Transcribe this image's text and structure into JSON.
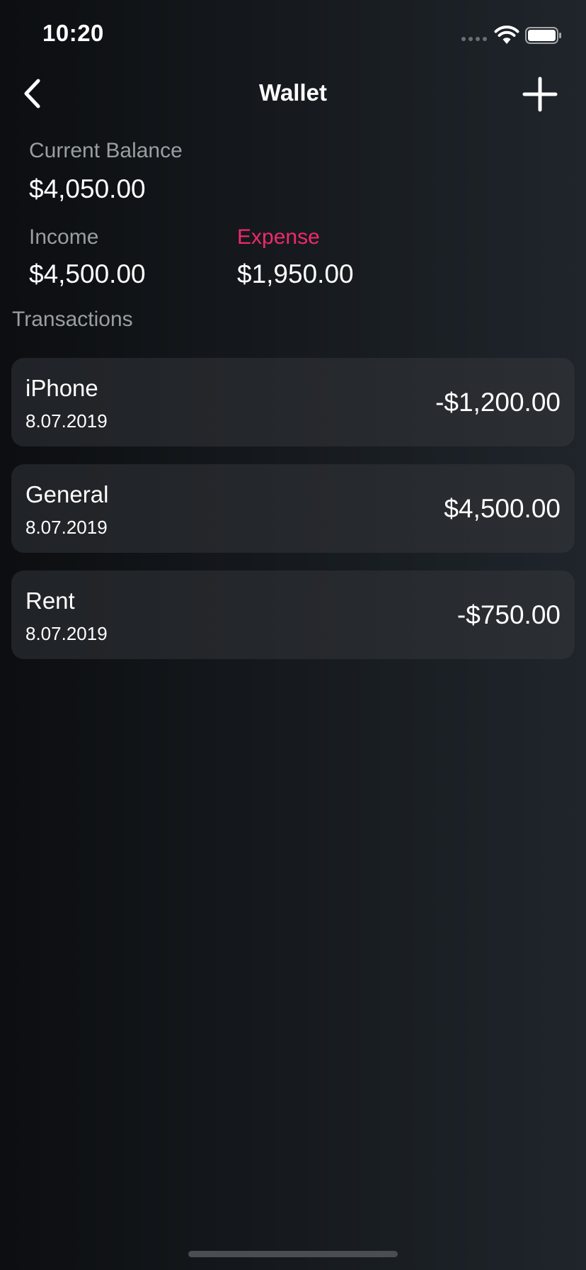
{
  "status_bar": {
    "time": "10:20"
  },
  "nav": {
    "title": "Wallet",
    "back_icon": "chevron-left-icon",
    "add_icon": "plus-icon"
  },
  "summary": {
    "balance_label": "Current Balance",
    "balance_value": "$4,050.00",
    "income_label": "Income",
    "income_value": "$4,500.00",
    "expense_label": "Expense",
    "expense_value": "$1,950.00"
  },
  "transactions": {
    "heading": "Transactions",
    "items": [
      {
        "title": "iPhone",
        "date": "8.07.2019",
        "amount": "-$1,200.00"
      },
      {
        "title": "General",
        "date": "8.07.2019",
        "amount": "$4,500.00"
      },
      {
        "title": "Rent",
        "date": "8.07.2019",
        "amount": "-$750.00"
      }
    ]
  },
  "colors": {
    "expense_accent": "#f0296a",
    "text_primary": "#ffffff",
    "text_muted": "#9a9ea3",
    "card_background": "#25282c"
  }
}
